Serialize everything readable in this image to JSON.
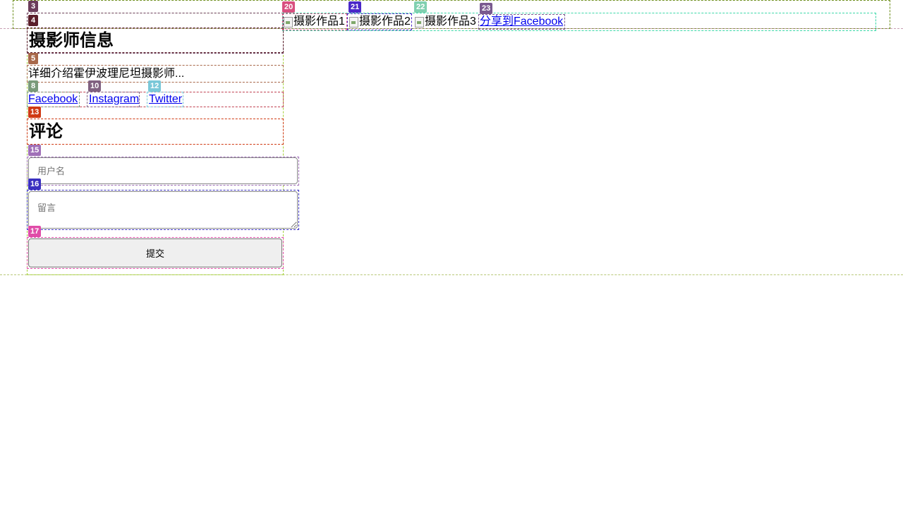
{
  "photographer": {
    "heading": "摄影师信息",
    "description": "详细介绍霍伊波理尼坦摄影师...",
    "social_links": [
      {
        "label": "Facebook"
      },
      {
        "label": "Instagram"
      },
      {
        "label": "Twitter"
      }
    ]
  },
  "comments": {
    "heading": "评论",
    "username_placeholder": "用户名",
    "message_placeholder": "留言",
    "submit_label": "提交"
  },
  "gallery": {
    "images": [
      {
        "alt": "摄影作品1"
      },
      {
        "alt": "摄影作品2"
      },
      {
        "alt": "摄影作品3"
      }
    ],
    "share_label": "分享到Facebook"
  },
  "marker_labels": {
    "m3": "3",
    "m4": "4",
    "m5": "5",
    "m8": "8",
    "m10": "10",
    "m12": "12",
    "m13": "13",
    "m15": "15",
    "m16": "16",
    "m17": "17",
    "m20": "20",
    "m21": "21",
    "m22": "22",
    "m23": "23"
  },
  "marker_colors": {
    "m3": "#6b3d5a",
    "m4": "#5a1e2a",
    "m5": "#a8684a",
    "m8": "#7a9a7a",
    "m10": "#806080",
    "m12": "#7ac8d8",
    "m13": "#d03a14",
    "m15": "#a070b8",
    "m16": "#3a30c0",
    "m17": "#e04ca8",
    "m20": "#d85080",
    "m21": "#4a28c8",
    "m22": "#80d0b0",
    "m23": "#7a5a90"
  }
}
